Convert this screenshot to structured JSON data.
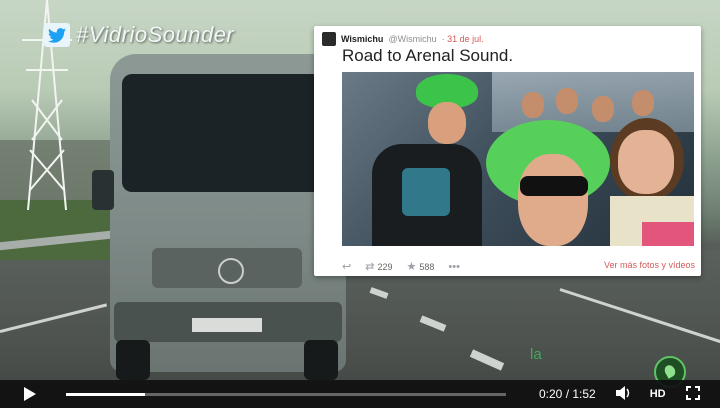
{
  "overlay": {
    "hashtag": "#VidrioSounder",
    "watermark": "la",
    "twitter_icon": "twitter-bird-icon"
  },
  "tweet": {
    "name": "Wismichu",
    "handle": "@Wismichu",
    "date": "· 31 de jul.",
    "text": "Road to Arenal Sound.",
    "retweets": "229",
    "favorites": "588",
    "more_link": "Ver más fotos y vídeos",
    "icons": [
      "reply-icon",
      "retweet-icon",
      "star-icon",
      "more-icon"
    ]
  },
  "player": {
    "current_time": "0:20",
    "separator": " / ",
    "duration": "1:52",
    "progress_fraction": 0.179,
    "hd_label": "HD",
    "accent": "#ffffff"
  },
  "colors": {
    "link": "#d35a5a",
    "controls_bg": "#0f0f0f"
  }
}
